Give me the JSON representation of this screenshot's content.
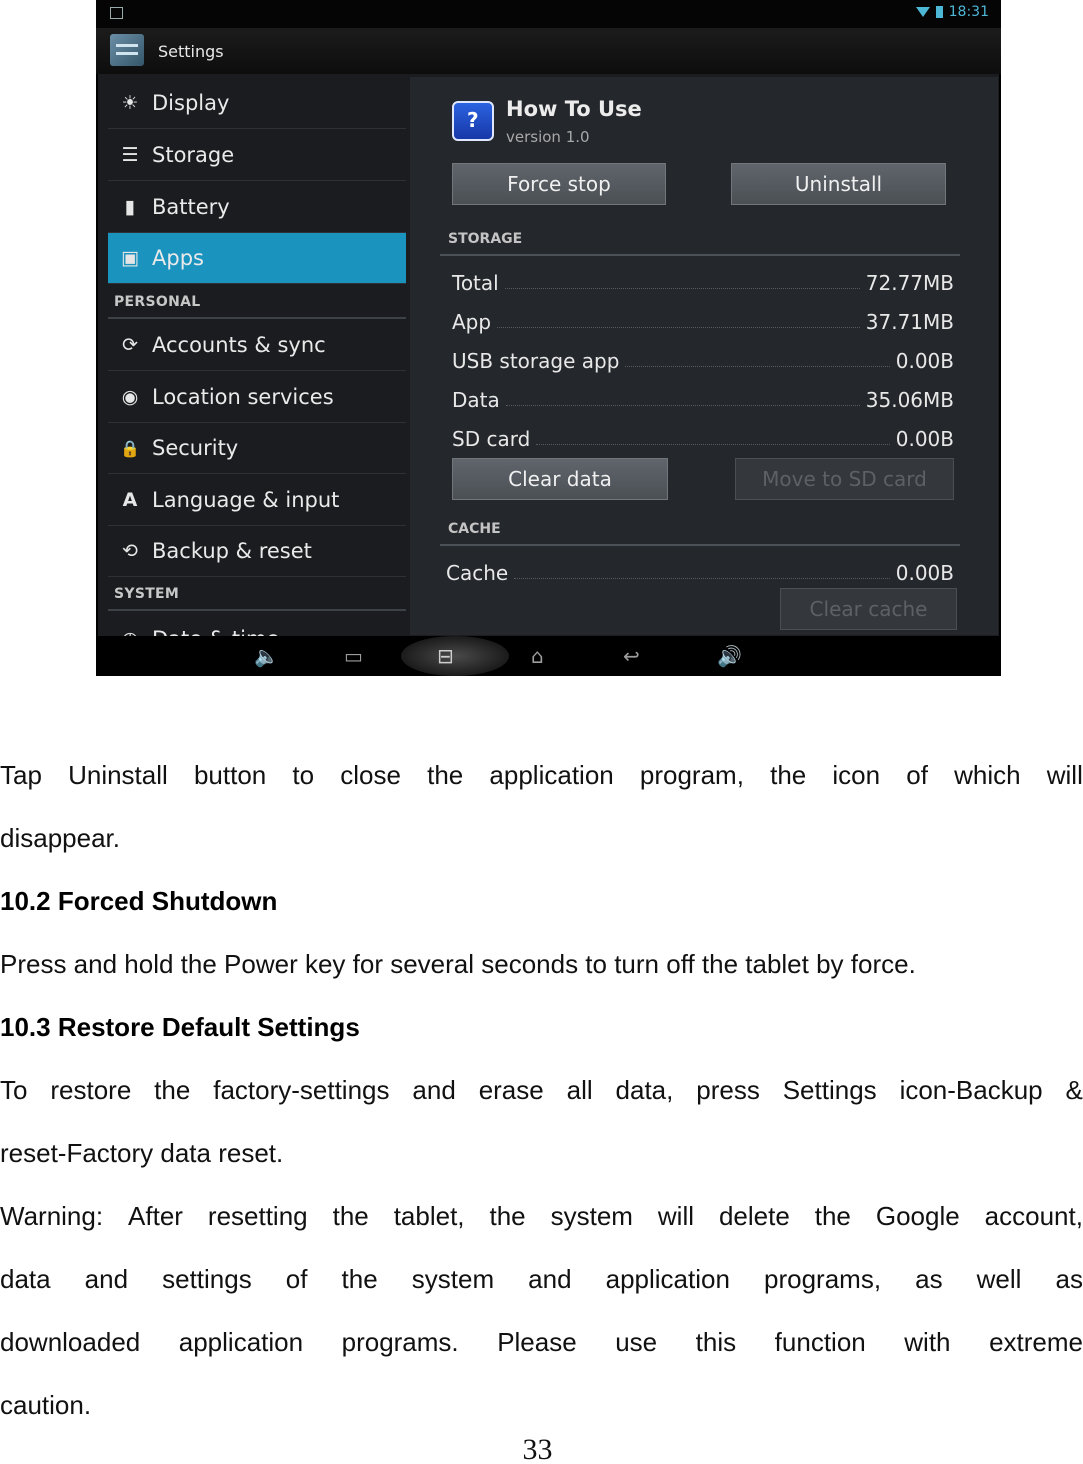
{
  "screenshot": {
    "status_time": "18:31",
    "action_bar_title": "Settings",
    "sidebar": {
      "items": [
        {
          "icon": "display-icon",
          "glyph": "☀",
          "label": "Display",
          "active": false
        },
        {
          "icon": "storage-icon",
          "glyph": "☰",
          "label": "Storage",
          "active": false
        },
        {
          "icon": "battery-icon",
          "glyph": "▮",
          "label": "Battery",
          "active": false
        },
        {
          "icon": "apps-icon",
          "glyph": "▣",
          "label": "Apps",
          "active": true
        },
        {
          "icon": "sync-icon",
          "glyph": "⟳",
          "label": "Accounts & sync",
          "active": false
        },
        {
          "icon": "location-icon",
          "glyph": "◉",
          "label": "Location services",
          "active": false
        },
        {
          "icon": "lock-icon",
          "glyph": "🔒",
          "label": "Security",
          "active": false
        },
        {
          "icon": "language-icon",
          "glyph": "A",
          "label": "Language & input",
          "active": false
        },
        {
          "icon": "backup-icon",
          "glyph": "⟲",
          "label": "Backup & reset",
          "active": false
        },
        {
          "icon": "clock-icon",
          "glyph": "◷",
          "label": "Date & time",
          "active": false
        }
      ],
      "headers": {
        "personal": "PERSONAL",
        "system": "SYSTEM"
      }
    },
    "app": {
      "name": "How To Use",
      "version": "version 1.0",
      "icon_glyph": "?"
    },
    "buttons": {
      "force_stop": "Force stop",
      "uninstall": "Uninstall",
      "clear_data": "Clear data",
      "move_to_sd": "Move to SD card",
      "clear_cache": "Clear cache"
    },
    "storage": {
      "header": "STORAGE",
      "rows": [
        {
          "label": "Total",
          "value": "72.77MB"
        },
        {
          "label": "App",
          "value": "37.71MB"
        },
        {
          "label": "USB storage app",
          "value": "0.00B"
        },
        {
          "label": "Data",
          "value": "35.06MB"
        },
        {
          "label": "SD card",
          "value": "0.00B"
        }
      ]
    },
    "cache": {
      "header": "CACHE",
      "rows": [
        {
          "label": "Cache",
          "value": "0.00B"
        }
      ]
    },
    "nav": {
      "volume_down": "🔈",
      "recent": "▭",
      "screenshot": "⊟",
      "home": "⌂",
      "back": "↩",
      "volume_up": "🔊"
    }
  },
  "document": {
    "para1_line1": [
      "Tap",
      "Uninstall",
      "button",
      "to",
      "close",
      "the",
      "application",
      "program,",
      "the",
      "icon",
      "of",
      "which",
      "will"
    ],
    "para1_line2": "disappear.",
    "heading_10_2": "10.2 Forced Shutdown",
    "para2": "Press and hold the Power key for several seconds to turn off the tablet by force.",
    "heading_10_3": "10.3 Restore Default Settings",
    "para3_line1": [
      "To",
      "restore",
      "the",
      "factory-settings",
      "and",
      "erase",
      "all",
      "data,",
      "press",
      "Settings",
      "icon-Backup",
      "&"
    ],
    "para3_line2": "reset-Factory data reset.",
    "para4_line1": [
      "Warning:",
      "After",
      "resetting",
      "the",
      "tablet,",
      "the",
      "system",
      "will",
      "delete",
      "the",
      "Google",
      "account,"
    ],
    "para4_line2": [
      "data",
      "and",
      "settings",
      "of",
      "the",
      "system",
      "and",
      "application",
      "programs,",
      "as",
      "well",
      "as"
    ],
    "para4_line3": [
      "downloaded",
      "application",
      "programs.",
      "Please",
      "use",
      "this",
      "function",
      "with",
      "extreme"
    ],
    "para4_line4": "caution.",
    "page_number": "33"
  }
}
